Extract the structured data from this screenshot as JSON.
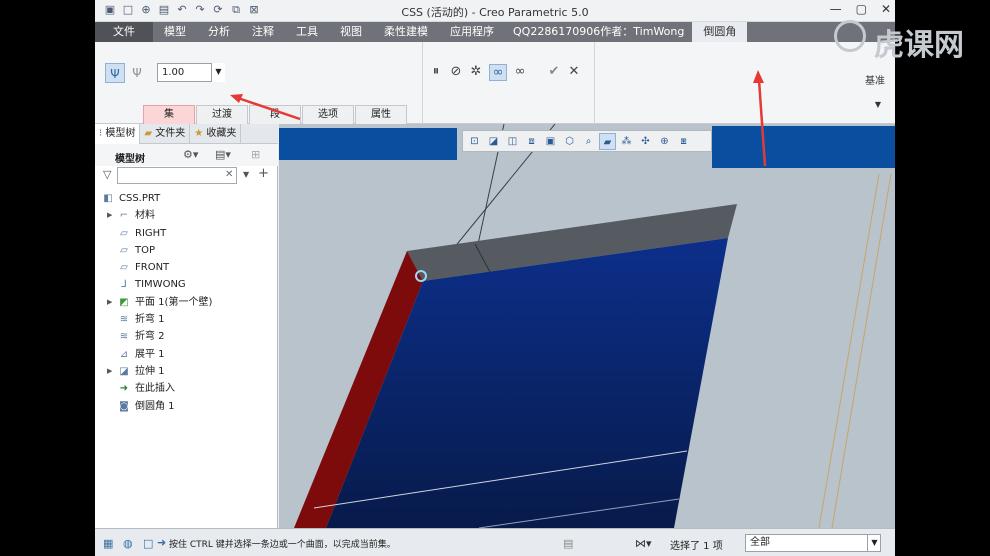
{
  "window": {
    "title": "CSS (活动的) - Creo Parametric 5.0",
    "controls": [
      "—",
      "▢",
      "✕"
    ]
  },
  "tabs": [
    {
      "label": "文件"
    },
    {
      "label": "模型"
    },
    {
      "label": "分析"
    },
    {
      "label": "注释"
    },
    {
      "label": "工具"
    },
    {
      "label": "视图"
    },
    {
      "label": "柔性建模"
    },
    {
      "label": "应用程序"
    },
    {
      "label": "QQ2286170906作者：TimWong"
    },
    {
      "label": "倒圆角"
    }
  ],
  "ribbon": {
    "radius_value": "1.00",
    "subtabs": [
      "集",
      "过渡",
      "段",
      "选项",
      "属性"
    ],
    "datum_label": "基准"
  },
  "watermark": "虎课网",
  "model_tree": {
    "tabs": [
      "模型树",
      "文件夹",
      "收藏夹"
    ],
    "toolbar_label": "模型树",
    "items": [
      {
        "label": "CSS.PRT",
        "icon": "part-icon"
      },
      {
        "label": "材料",
        "icon": "material-icon"
      },
      {
        "label": "RIGHT",
        "icon": "datum-plane-icon"
      },
      {
        "label": "TOP",
        "icon": "datum-plane-icon"
      },
      {
        "label": "FRONT",
        "icon": "datum-plane-icon"
      },
      {
        "label": "TIMWONG",
        "icon": "csys-icon"
      },
      {
        "label": "平面 1(第一个壁)",
        "icon": "wall-icon"
      },
      {
        "label": "折弯 1",
        "icon": "bend-icon"
      },
      {
        "label": "折弯 2",
        "icon": "bend-icon"
      },
      {
        "label": "展平 1",
        "icon": "unbend-icon"
      },
      {
        "label": "拉伸 1",
        "icon": "extrude-icon"
      },
      {
        "label": "在此插入",
        "icon": "insert-here-icon"
      },
      {
        "label": "倒圆角 1",
        "icon": "round-icon"
      }
    ]
  },
  "status": {
    "message": "按住 CTRL 键并选择一条边或一个曲面，以完成当前集。",
    "selection": "选择了 1 项",
    "filter": "全部"
  },
  "colors": {
    "accent_red": "#e53935",
    "model_blue": "#0a2a6e",
    "edge_red": "#8b0d0d",
    "top_gray": "#555a60"
  }
}
